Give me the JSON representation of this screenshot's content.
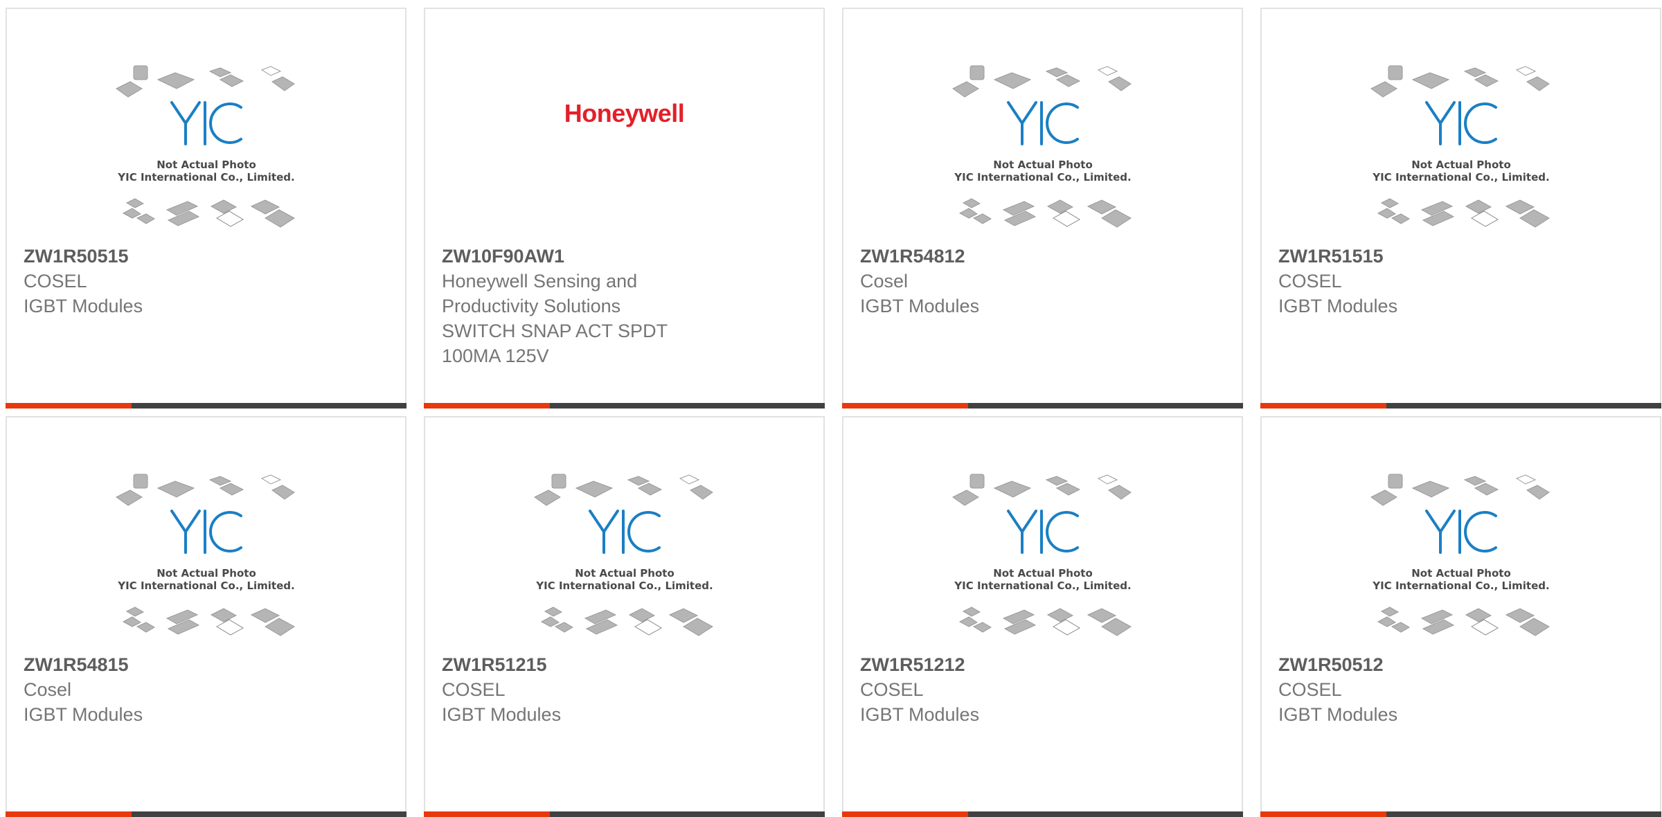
{
  "products": [
    {
      "part": "ZW1R50515",
      "brand": "COSEL",
      "desc": "IGBT Modules",
      "image": "yic-placeholder"
    },
    {
      "part": "ZW10F90AW1",
      "brand": "Honeywell Sensing and Productivity Solutions",
      "desc": "SWITCH SNAP ACT SPDT 100MA 125V",
      "image": "honeywell-logo",
      "logo_text": "Honeywell"
    },
    {
      "part": "ZW1R54812",
      "brand": "Cosel",
      "desc": "IGBT Modules",
      "image": "yic-placeholder"
    },
    {
      "part": "ZW1R51515",
      "brand": "COSEL",
      "desc": "IGBT Modules",
      "image": "yic-placeholder"
    },
    {
      "part": "ZW1R54815",
      "brand": "Cosel",
      "desc": "IGBT Modules",
      "image": "yic-placeholder"
    },
    {
      "part": "ZW1R51215",
      "brand": "COSEL",
      "desc": "IGBT Modules",
      "image": "yic-placeholder"
    },
    {
      "part": "ZW1R51212",
      "brand": "COSEL",
      "desc": "IGBT Modules",
      "image": "yic-placeholder"
    },
    {
      "part": "ZW1R50512",
      "brand": "COSEL",
      "desc": "IGBT Modules",
      "image": "yic-placeholder"
    }
  ],
  "placeholder": {
    "line1": "Not Actual Photo",
    "line2": "YIC International Co., Limited.",
    "logo_text": "YIC"
  },
  "colors": {
    "accent": "#e8380d",
    "bar": "#414141",
    "honeywell_red": "#e3202a",
    "yic_blue": "#1b7fc4"
  }
}
